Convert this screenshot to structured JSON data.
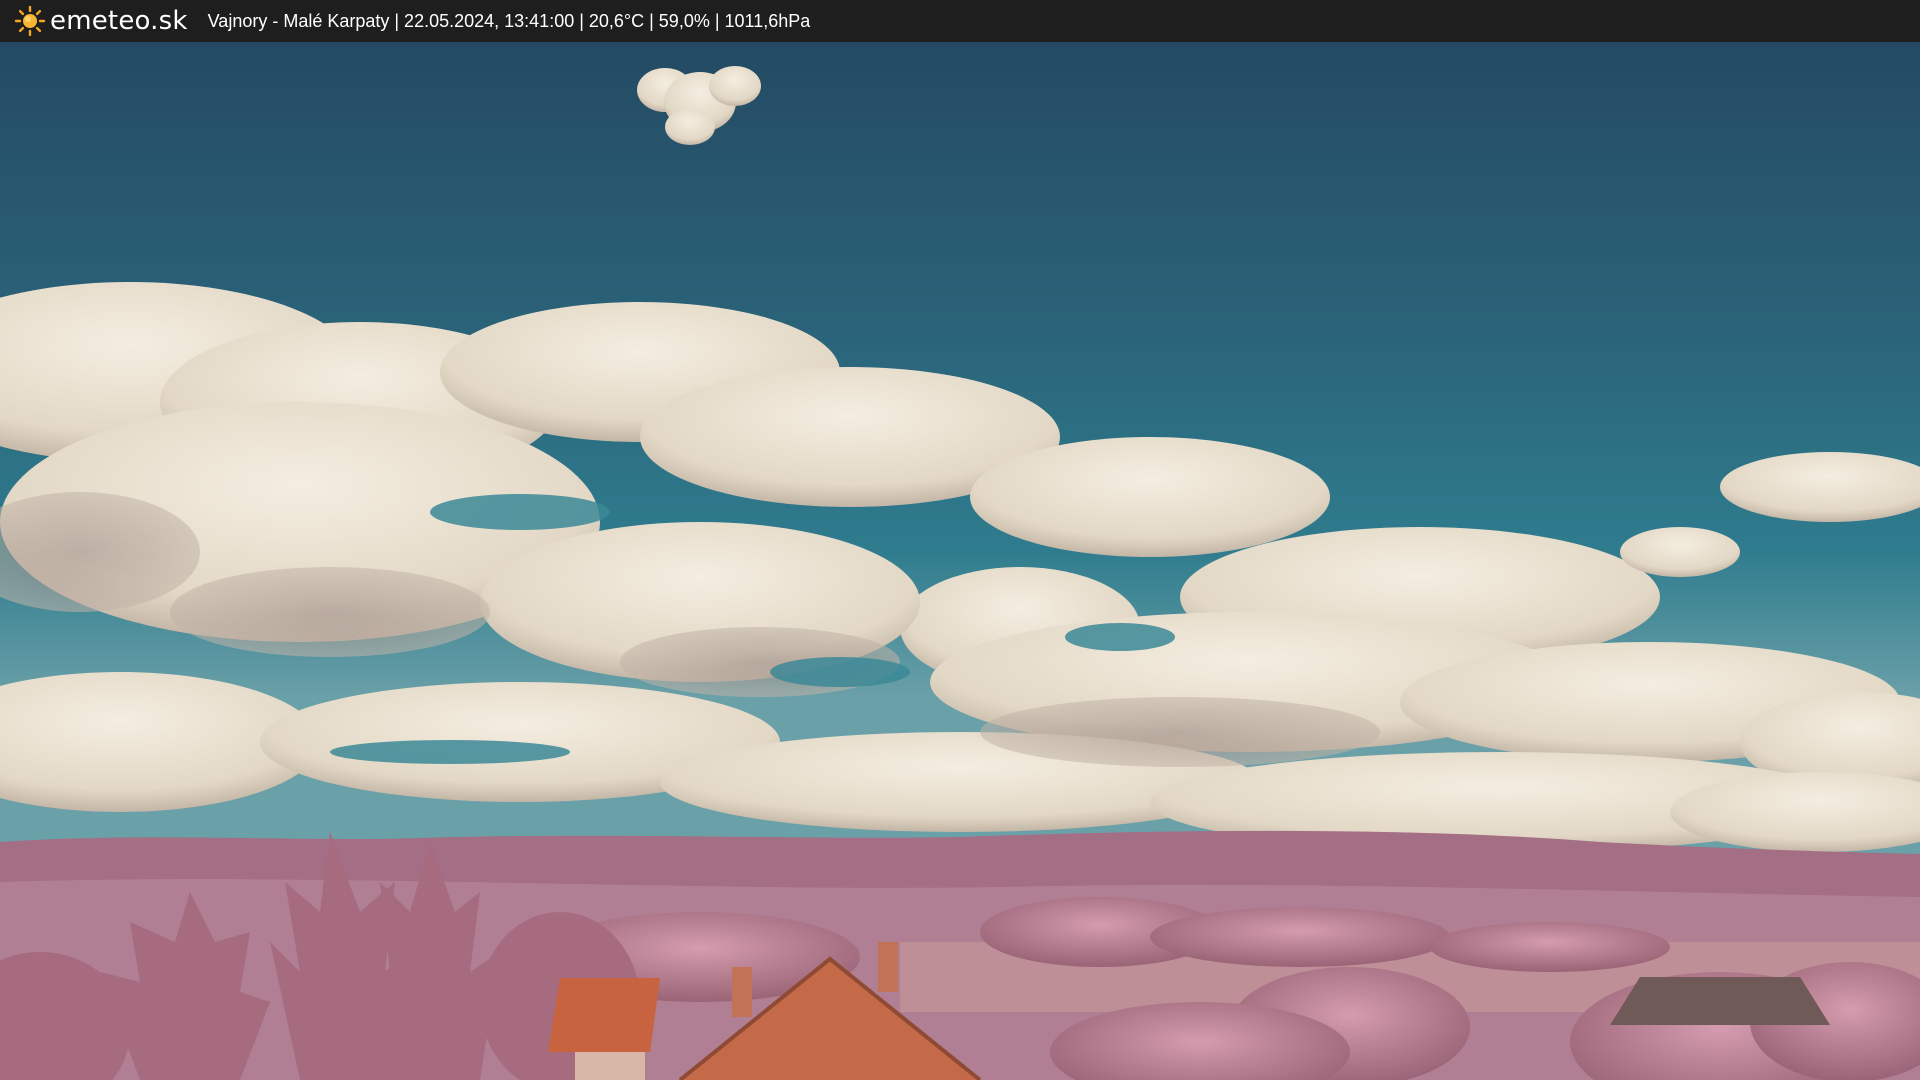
{
  "brand": {
    "name": "emeteo.sk",
    "icon": "sun-icon"
  },
  "caption": {
    "text": "Vajnory - Malé Karpaty | 22.05.2024, 13:41:00 | 20,6°C | 59,0% | 1011,6hPa"
  },
  "colors": {
    "bar_background": "#1e1e1e",
    "sun": "#f5a623",
    "sky_top": "#254d65",
    "sky_low": "#2f7a8e",
    "cloud": "#e8e0d2",
    "hills": "#b07d92",
    "foliage": "#c98fa2",
    "roof": "#c8633f"
  }
}
